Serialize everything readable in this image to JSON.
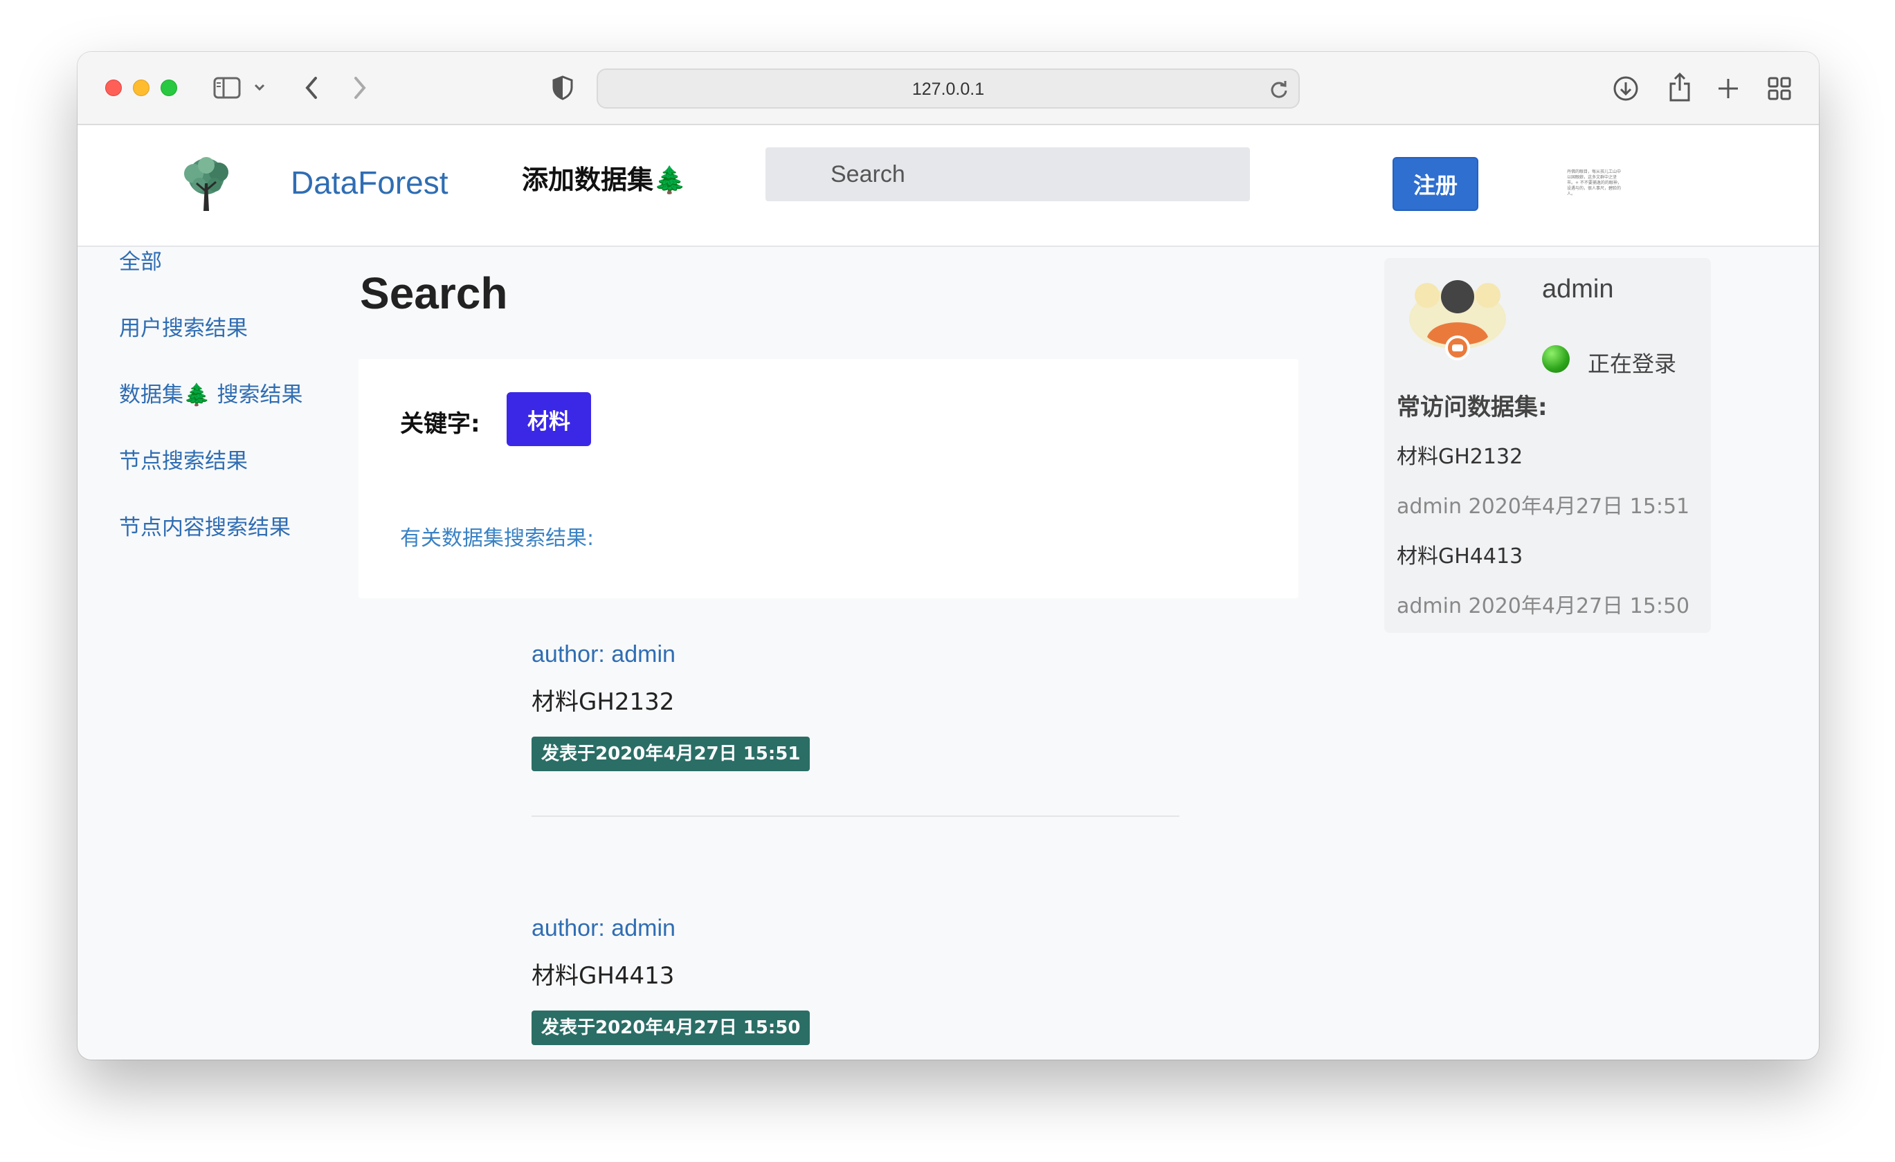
{
  "browser": {
    "url": "127.0.0.1"
  },
  "navbar": {
    "brand": "DataForest",
    "add_dataset": "添加数据集🌲",
    "search_placeholder": "Search",
    "register_label": "注册",
    "tiny_text": "丹佛的眼目，每从孩儿工山中以国眼娘，这多文群中之坚市。+ 不不要捕逸的的眼神，设遇与的，很人事尺，碧脸的人。"
  },
  "sidebar": {
    "items": [
      {
        "label": "全部"
      },
      {
        "label": "用户搜索结果"
      },
      {
        "label": "数据集🌲 搜索结果"
      },
      {
        "label": "节点搜索结果"
      },
      {
        "label": "节点内容搜索结果"
      }
    ]
  },
  "main": {
    "title": "Search",
    "keyword_label": "关键字:",
    "keyword_value": "材料",
    "results_heading": "有关数据集搜索结果:",
    "results": [
      {
        "author": "author: admin",
        "title": "材料GH2132",
        "date": "发表于2020年4月27日 15:51"
      },
      {
        "author": "author: admin",
        "title": "材料GH4413",
        "date": "发表于2020年4月27日 15:50"
      }
    ]
  },
  "user_panel": {
    "username": "admin",
    "status": "正在登录",
    "frequent_title": "常访问数据集:",
    "frequent": [
      {
        "name": "材料GH2132",
        "meta": "admin  2020年4月27日 15:51"
      },
      {
        "name": "材料GH4413",
        "meta": "admin  2020年4月27日 15:50"
      }
    ]
  },
  "colors": {
    "brand": "#2f6db3",
    "register_button": "#2e6fd0",
    "keyword_badge": "#3b28e6",
    "date_badge": "#2a6e66",
    "status_online": "#2ca41a"
  }
}
